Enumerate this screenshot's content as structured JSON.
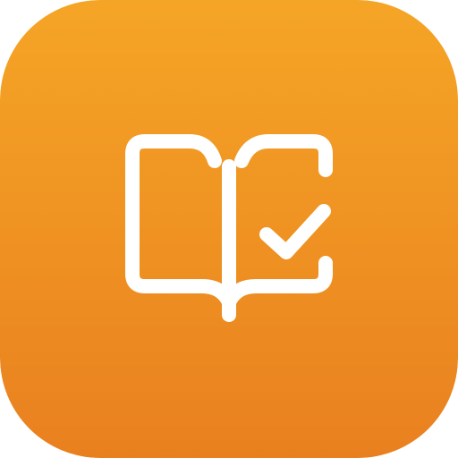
{
  "app_icon": {
    "icon": "book-checkmark-icon",
    "glyph_color": "#ffffff",
    "background_gradient": {
      "top": "#f5a526",
      "bottom": "#e9801f"
    }
  }
}
